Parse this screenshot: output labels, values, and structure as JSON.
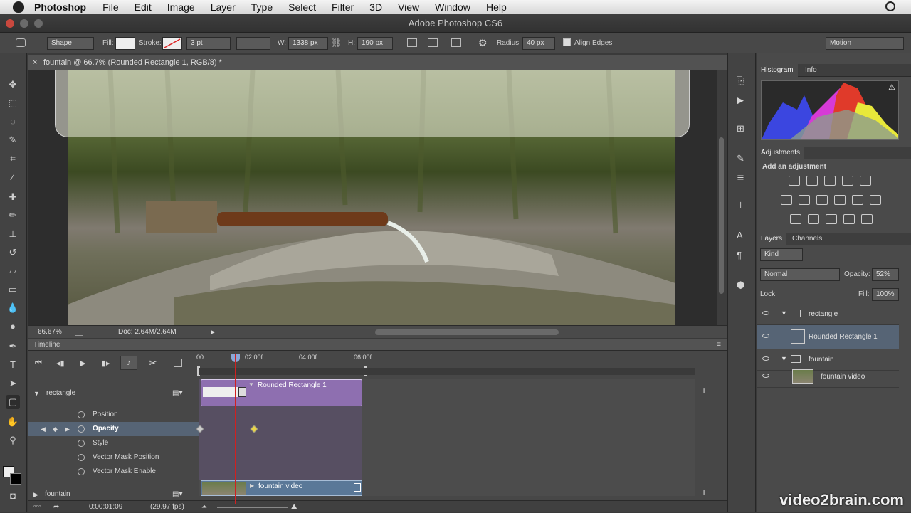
{
  "menubar": {
    "app": "Photoshop",
    "items": [
      "File",
      "Edit",
      "Image",
      "Layer",
      "Type",
      "Select",
      "Filter",
      "3D",
      "View",
      "Window",
      "Help"
    ]
  },
  "window": {
    "title": "Adobe Photoshop CS6"
  },
  "options": {
    "shape_mode": "Shape",
    "fill_label": "Fill:",
    "stroke_label": "Stroke:",
    "stroke_width": "3 pt",
    "w_label": "W:",
    "w_value": "1338 px",
    "h_label": "H:",
    "h_value": "190 px",
    "radius_label": "Radius:",
    "radius_value": "40 px",
    "align_edges": "Align Edges",
    "workspace": "Motion"
  },
  "document": {
    "tab_title": "fountain @ 66.7% (Rounded Rectangle 1, RGB/8) *",
    "zoom": "66.67%",
    "doc_size": "Doc: 2.64M/2.64M"
  },
  "timeline": {
    "title": "Timeline",
    "ruler": [
      "00",
      "02:00f",
      "04:00f",
      "06:00f"
    ],
    "group_rectangle": "rectangle",
    "props": [
      "Position",
      "Opacity",
      "Style",
      "Vector Mask Position",
      "Vector Mask Enable"
    ],
    "clip_rect": "Rounded Rectangle 1",
    "group_fountain": "fountain",
    "clip_video": "fountain video",
    "current_time": "0:00:01:09",
    "fps": "(29.97 fps)"
  },
  "panels": {
    "histogram_tab": "Histogram",
    "info_tab": "Info",
    "adjustments_tab": "Adjustments",
    "add_adjustment": "Add an adjustment",
    "layers_tab": "Layers",
    "channels_tab": "Channels",
    "kind": "Kind",
    "blend_mode": "Normal",
    "opacity_label": "Opacity:",
    "opacity_value": "52%",
    "lock_label": "Lock:",
    "fill_label": "Fill:",
    "fill_value": "100%"
  },
  "layers": [
    {
      "name": "rectangle",
      "type": "group"
    },
    {
      "name": "Rounded Rectangle 1",
      "type": "shape"
    },
    {
      "name": "fountain",
      "type": "group"
    },
    {
      "name": "fountain video",
      "type": "video"
    }
  ],
  "watermark": "video2brain.com",
  "colors": {
    "accent_purple": "#8e6fb0",
    "video_blue": "#5a7898",
    "playhead": "#d02020",
    "selected_row": "#566475"
  }
}
